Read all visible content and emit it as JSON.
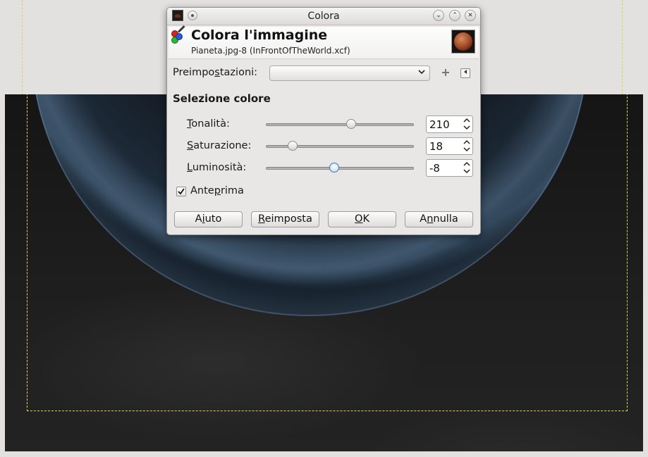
{
  "window": {
    "title": "Colora",
    "controls": {
      "minimize": "⌄",
      "maximize": "⌃",
      "close": "✕"
    }
  },
  "header": {
    "title": "Colora l'immagine",
    "subtitle": "Pianeta.jpg-8 (InFrontOfTheWorld.xcf)"
  },
  "presets": {
    "label_pre": "Preimpo",
    "label_mnemonic": "s",
    "label_post": "tazioni:",
    "selected": "",
    "dropdown_icon": "chevron-down-icon",
    "add_icon": "plus-icon",
    "menu_icon": "triangle-left-icon"
  },
  "section": {
    "title": "Selezione colore"
  },
  "sliders": [
    {
      "mnemonic": "T",
      "rest": "onalità:",
      "value": "210",
      "position": 0.575,
      "min": 0,
      "max": 360,
      "active": false
    },
    {
      "mnemonic": "S",
      "rest": "aturazione:",
      "value": "18",
      "position": 0.18,
      "min": 0,
      "max": 100,
      "active": false
    },
    {
      "mnemonic": "L",
      "rest": "uminosità:",
      "value": "-8",
      "position": 0.46,
      "min": -100,
      "max": 100,
      "active": true
    }
  ],
  "preview": {
    "checked": true,
    "label_pre": "Ante",
    "label_mnemonic": "p",
    "label_post": "rima"
  },
  "buttons": {
    "help": {
      "pre": "A",
      "mnemonic": "i",
      "post": "uto"
    },
    "reset": {
      "pre": "",
      "mnemonic": "R",
      "post": "eimposta"
    },
    "ok": {
      "pre": "",
      "mnemonic": "O",
      "post": "K"
    },
    "cancel": {
      "pre": "A",
      "mnemonic": "n",
      "post": "nulla"
    }
  },
  "colors": {
    "accent": "#3f7cc0",
    "selection_marquee": "#d8d35a",
    "dialog_bg": "#e8e7e5"
  }
}
